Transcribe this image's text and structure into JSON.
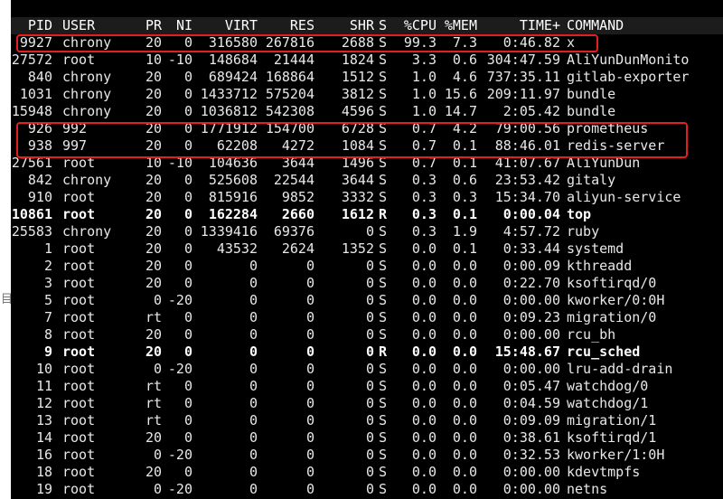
{
  "left_glyph": "目",
  "highlight_color": "#e61e1e",
  "columns": [
    "PID",
    "USER",
    "PR",
    "NI",
    "VIRT",
    "RES",
    "SHR",
    "S",
    "%CPU",
    "%MEM",
    "TIME+",
    "COMMAND"
  ],
  "rows": [
    {
      "pid": "9927",
      "user": "chrony",
      "pr": "20",
      "ni": "0",
      "virt": "316580",
      "res": "267816",
      "shr": "2688",
      "s": "S",
      "cpu": "99.3",
      "mem": "7.3",
      "time": "0:46.82",
      "cmd": "x"
    },
    {
      "pid": "27572",
      "user": "root",
      "pr": "10",
      "ni": "-10",
      "virt": "148684",
      "res": "21444",
      "shr": "1824",
      "s": "S",
      "cpu": "3.3",
      "mem": "0.6",
      "time": "304:47.59",
      "cmd": "AliYunDunMonito"
    },
    {
      "pid": "840",
      "user": "chrony",
      "pr": "20",
      "ni": "0",
      "virt": "689424",
      "res": "168864",
      "shr": "1512",
      "s": "S",
      "cpu": "1.0",
      "mem": "4.6",
      "time": "737:35.11",
      "cmd": "gitlab-exporter"
    },
    {
      "pid": "1031",
      "user": "chrony",
      "pr": "20",
      "ni": "0",
      "virt": "1433712",
      "res": "575204",
      "shr": "3812",
      "s": "S",
      "cpu": "1.0",
      "mem": "15.6",
      "time": "209:11.97",
      "cmd": "bundle"
    },
    {
      "pid": "15948",
      "user": "chrony",
      "pr": "20",
      "ni": "0",
      "virt": "1036812",
      "res": "542308",
      "shr": "4596",
      "s": "S",
      "cpu": "1.0",
      "mem": "14.7",
      "time": "2:05.42",
      "cmd": "bundle"
    },
    {
      "pid": "926",
      "user": "992",
      "pr": "20",
      "ni": "0",
      "virt": "1771912",
      "res": "154700",
      "shr": "6728",
      "s": "S",
      "cpu": "0.7",
      "mem": "4.2",
      "time": "79:00.56",
      "cmd": "prometheus"
    },
    {
      "pid": "938",
      "user": "997",
      "pr": "20",
      "ni": "0",
      "virt": "62208",
      "res": "4272",
      "shr": "1084",
      "s": "S",
      "cpu": "0.7",
      "mem": "0.1",
      "time": "88:46.01",
      "cmd": "redis-server"
    },
    {
      "pid": "27561",
      "user": "root",
      "pr": "10",
      "ni": "-10",
      "virt": "104636",
      "res": "3644",
      "shr": "1496",
      "s": "S",
      "cpu": "0.7",
      "mem": "0.1",
      "time": "41:07.67",
      "cmd": "AliYunDun"
    },
    {
      "pid": "842",
      "user": "chrony",
      "pr": "20",
      "ni": "0",
      "virt": "525608",
      "res": "22544",
      "shr": "3644",
      "s": "S",
      "cpu": "0.3",
      "mem": "0.6",
      "time": "23:53.42",
      "cmd": "gitaly"
    },
    {
      "pid": "910",
      "user": "root",
      "pr": "20",
      "ni": "0",
      "virt": "815916",
      "res": "9852",
      "shr": "3332",
      "s": "S",
      "cpu": "0.3",
      "mem": "0.3",
      "time": "15:34.70",
      "cmd": "aliyun-service"
    },
    {
      "pid": "10861",
      "user": "root",
      "pr": "20",
      "ni": "0",
      "virt": "162284",
      "res": "2660",
      "shr": "1612",
      "s": "R",
      "cpu": "0.3",
      "mem": "0.1",
      "time": "0:00.04",
      "cmd": "top",
      "bold": true
    },
    {
      "pid": "25583",
      "user": "chrony",
      "pr": "20",
      "ni": "0",
      "virt": "1339416",
      "res": "69376",
      "shr": "0",
      "s": "S",
      "cpu": "0.3",
      "mem": "1.9",
      "time": "4:57.72",
      "cmd": "ruby"
    },
    {
      "pid": "1",
      "user": "root",
      "pr": "20",
      "ni": "0",
      "virt": "43532",
      "res": "2624",
      "shr": "1352",
      "s": "S",
      "cpu": "0.0",
      "mem": "0.1",
      "time": "0:33.44",
      "cmd": "systemd"
    },
    {
      "pid": "2",
      "user": "root",
      "pr": "20",
      "ni": "0",
      "virt": "0",
      "res": "0",
      "shr": "0",
      "s": "S",
      "cpu": "0.0",
      "mem": "0.0",
      "time": "0:00.09",
      "cmd": "kthreadd"
    },
    {
      "pid": "3",
      "user": "root",
      "pr": "20",
      "ni": "0",
      "virt": "0",
      "res": "0",
      "shr": "0",
      "s": "S",
      "cpu": "0.0",
      "mem": "0.0",
      "time": "0:22.70",
      "cmd": "ksoftirqd/0"
    },
    {
      "pid": "5",
      "user": "root",
      "pr": "0",
      "ni": "-20",
      "virt": "0",
      "res": "0",
      "shr": "0",
      "s": "S",
      "cpu": "0.0",
      "mem": "0.0",
      "time": "0:00.00",
      "cmd": "kworker/0:0H"
    },
    {
      "pid": "7",
      "user": "root",
      "pr": "rt",
      "ni": "0",
      "virt": "0",
      "res": "0",
      "shr": "0",
      "s": "S",
      "cpu": "0.0",
      "mem": "0.0",
      "time": "0:09.23",
      "cmd": "migration/0"
    },
    {
      "pid": "8",
      "user": "root",
      "pr": "20",
      "ni": "0",
      "virt": "0",
      "res": "0",
      "shr": "0",
      "s": "S",
      "cpu": "0.0",
      "mem": "0.0",
      "time": "0:00.00",
      "cmd": "rcu_bh"
    },
    {
      "pid": "9",
      "user": "root",
      "pr": "20",
      "ni": "0",
      "virt": "0",
      "res": "0",
      "shr": "0",
      "s": "R",
      "cpu": "0.0",
      "mem": "0.0",
      "time": "15:48.67",
      "cmd": "rcu_sched",
      "bold": true
    },
    {
      "pid": "10",
      "user": "root",
      "pr": "0",
      "ni": "-20",
      "virt": "0",
      "res": "0",
      "shr": "0",
      "s": "S",
      "cpu": "0.0",
      "mem": "0.0",
      "time": "0:00.00",
      "cmd": "lru-add-drain"
    },
    {
      "pid": "11",
      "user": "root",
      "pr": "rt",
      "ni": "0",
      "virt": "0",
      "res": "0",
      "shr": "0",
      "s": "S",
      "cpu": "0.0",
      "mem": "0.0",
      "time": "0:05.47",
      "cmd": "watchdog/0"
    },
    {
      "pid": "12",
      "user": "root",
      "pr": "rt",
      "ni": "0",
      "virt": "0",
      "res": "0",
      "shr": "0",
      "s": "S",
      "cpu": "0.0",
      "mem": "0.0",
      "time": "0:04.59",
      "cmd": "watchdog/1"
    },
    {
      "pid": "13",
      "user": "root",
      "pr": "rt",
      "ni": "0",
      "virt": "0",
      "res": "0",
      "shr": "0",
      "s": "S",
      "cpu": "0.0",
      "mem": "0.0",
      "time": "0:09.09",
      "cmd": "migration/1"
    },
    {
      "pid": "14",
      "user": "root",
      "pr": "20",
      "ni": "0",
      "virt": "0",
      "res": "0",
      "shr": "0",
      "s": "S",
      "cpu": "0.0",
      "mem": "0.0",
      "time": "0:38.61",
      "cmd": "ksoftirqd/1"
    },
    {
      "pid": "16",
      "user": "root",
      "pr": "0",
      "ni": "-20",
      "virt": "0",
      "res": "0",
      "shr": "0",
      "s": "S",
      "cpu": "0.0",
      "mem": "0.0",
      "time": "0:32.53",
      "cmd": "kworker/1:0H"
    },
    {
      "pid": "18",
      "user": "root",
      "pr": "20",
      "ni": "0",
      "virt": "0",
      "res": "0",
      "shr": "0",
      "s": "S",
      "cpu": "0.0",
      "mem": "0.0",
      "time": "0:00.00",
      "cmd": "kdevtmpfs"
    },
    {
      "pid": "19",
      "user": "root",
      "pr": "0",
      "ni": "-20",
      "virt": "0",
      "res": "0",
      "shr": "0",
      "s": "S",
      "cpu": "0.0",
      "mem": "0.0",
      "time": "0:00.00",
      "cmd": "netns"
    }
  ]
}
